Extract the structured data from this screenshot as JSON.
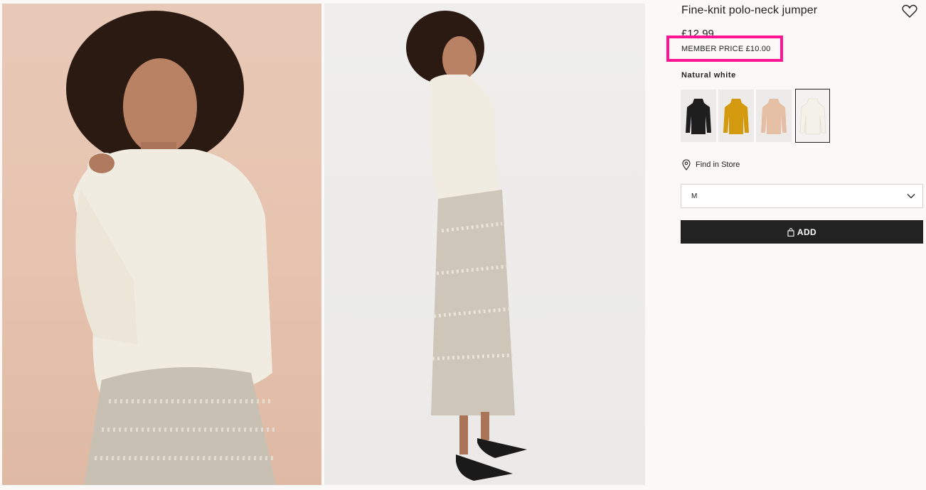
{
  "product": {
    "title": "Fine-knit polo-neck jumper",
    "price": "£12.99",
    "member_price": "MEMBER PRICE £10.00",
    "color_name": "Natural white",
    "colors": [
      {
        "name": "black",
        "hex": "#1e1e1e"
      },
      {
        "name": "mustard",
        "hex": "#d39a0f"
      },
      {
        "name": "beige",
        "hex": "#e5bfa3"
      },
      {
        "name": "natural-white",
        "hex": "#f2efe6"
      }
    ],
    "selected_color_index": 3
  },
  "store": {
    "find_label": "Find in Store"
  },
  "size": {
    "selected": "M"
  },
  "cart": {
    "add_label": "ADD"
  },
  "highlight_color": "#ff1493",
  "icons": [
    "heart-icon",
    "location-pin-icon",
    "chevron-down-icon",
    "bag-icon"
  ]
}
